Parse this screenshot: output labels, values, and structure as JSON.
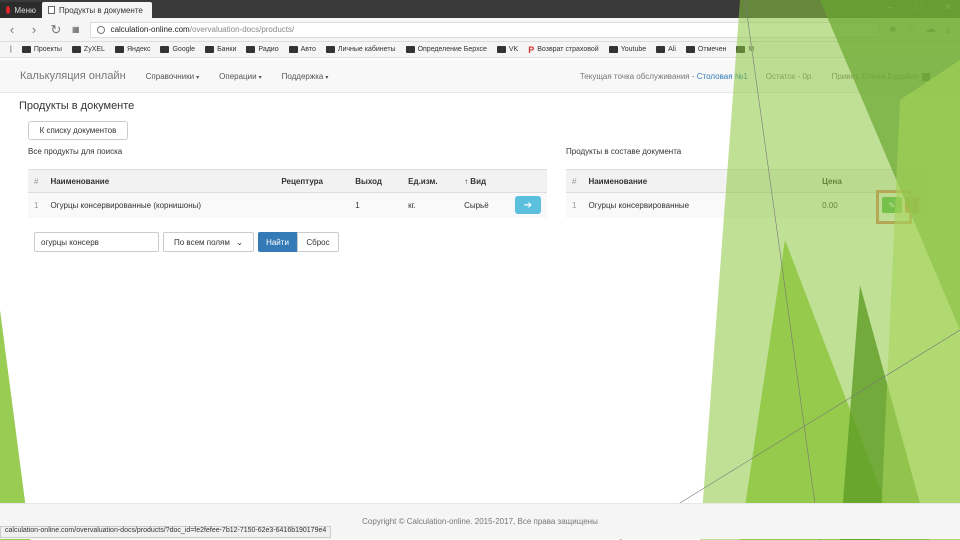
{
  "browser": {
    "menu_tab": "Меню",
    "active_tab": "Продукты в документе",
    "url_domain": "calculation-online.com",
    "url_path": "/overvaluation-docs/products/",
    "bookmarks": [
      "Проекты",
      "ZyXEL",
      "Яндекс",
      "Google",
      "Банки",
      "Радио",
      "Авто",
      "Личные кабинеты",
      "Определение Берхсе",
      "VK",
      "Возврат страховой",
      "Youtube",
      "Ali",
      "Отмечен",
      "M"
    ]
  },
  "navbar": {
    "brand": "Калькуляция онлайн",
    "items": [
      "Справочники",
      "Операции",
      "Поддержка"
    ],
    "service_point_label": "Текущая точка обслуживания - ",
    "service_point_link": "Столовая №1",
    "remainder": "Остаток - 0р.",
    "greeting": "Привет, Елена Будайло"
  },
  "page": {
    "title": "Продукты в документе",
    "back_button": "К списку документов",
    "left_section_title": "Все продукты для поиска",
    "right_section_title": "Продукты в составе документа"
  },
  "search_table": {
    "headers": [
      "#",
      "Наименование",
      "Рецептура",
      "Выход",
      "Ед.изм.",
      "↑ Вид"
    ],
    "rows": [
      {
        "num": "1",
        "name": "Огурцы консервированные (корнишоны)",
        "recipe": "",
        "output": "1",
        "unit": "кг.",
        "kind": "Сырьё"
      }
    ]
  },
  "search_form": {
    "query": "огурцы консерв",
    "field_select": "По всем полям",
    "find_button": "Найти",
    "reset_button": "Сброс"
  },
  "doc_table": {
    "headers": [
      "#",
      "Наименование",
      "Цена"
    ],
    "rows": [
      {
        "num": "1",
        "name": "Огурцы консервированные",
        "price": "0.00"
      }
    ]
  },
  "footer": {
    "copyright": "Copyright © Calculation-online. 2015-2017, Все права защищены"
  },
  "status_bar": {
    "url": "calculation-online.com/overvaluation-docs/products/?doc_id=fe2fefee-7b12-7150-62e3-6416b190179e4"
  },
  "colors": {
    "primary": "#337ab7",
    "info": "#5bc0de",
    "success": "#5cb85c",
    "danger": "#d9534f",
    "highlight": "#e58070",
    "deco_green": "#8dc63f"
  }
}
